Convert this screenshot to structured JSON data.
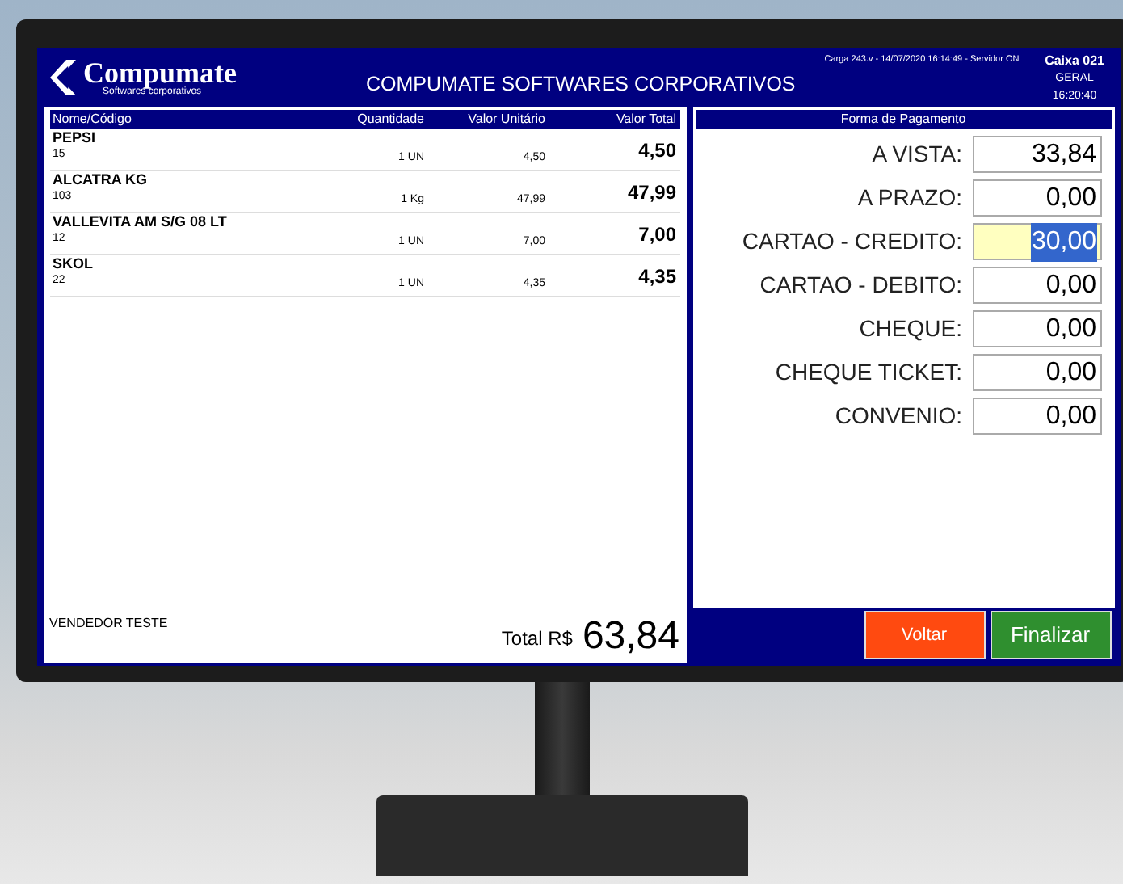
{
  "header": {
    "logo_name": "Compumate",
    "logo_tagline": "Softwares corporativos",
    "title": "COMPUMATE SOFTWARES CORPORATIVOS",
    "status": "Carga 243.v - 14/07/2020 16:14:49 - Servidor ON",
    "register": "Caixa 021",
    "group": "GERAL",
    "time": "16:20:40"
  },
  "items_table": {
    "columns": [
      "Nome/Código",
      "Quantidade",
      "Valor Unitário",
      "Valor Total"
    ],
    "rows": [
      {
        "name": "PEPSI",
        "code": "15",
        "quantity": "1 UN",
        "unit_price": "4,50",
        "total": "4,50"
      },
      {
        "name": "ALCATRA KG",
        "code": "103",
        "quantity": "1 Kg",
        "unit_price": "47,99",
        "total": "47,99"
      },
      {
        "name": "VALLEVITA AM S/G 08 LT",
        "code": "12",
        "quantity": "1 UN",
        "unit_price": "7,00",
        "total": "7,00"
      },
      {
        "name": "SKOL",
        "code": "22",
        "quantity": "1 UN",
        "unit_price": "4,35",
        "total": "4,35"
      }
    ]
  },
  "seller": "VENDEDOR TESTE",
  "total_label": "Total R$",
  "total_value": "63,84",
  "payment": {
    "title": "Forma de Pagamento",
    "fields": [
      {
        "label": "A VISTA:",
        "value": "33,84",
        "selected": false
      },
      {
        "label": "A PRAZO:",
        "value": "0,00",
        "selected": false
      },
      {
        "label": "CARTAO - CREDITO:",
        "value": "30,00",
        "selected": true
      },
      {
        "label": "CARTAO - DEBITO:",
        "value": "0,00",
        "selected": false
      },
      {
        "label": "CHEQUE:",
        "value": "0,00",
        "selected": false
      },
      {
        "label": "CHEQUE TICKET:",
        "value": "0,00",
        "selected": false
      },
      {
        "label": "CONVENIO:",
        "value": "0,00",
        "selected": false
      }
    ]
  },
  "buttons": [
    {
      "label": "Voltar",
      "kind": "secondary"
    },
    {
      "label": "Finalizar",
      "kind": "primary"
    }
  ]
}
